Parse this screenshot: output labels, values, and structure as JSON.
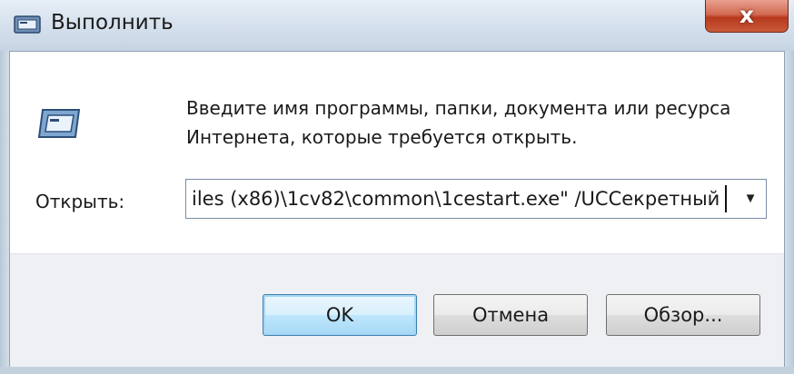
{
  "window": {
    "title": "Выполнить",
    "title_icon": "run-dialog-icon",
    "close_glyph": "x"
  },
  "dialog": {
    "program_icon": "run-program-icon",
    "prompt_line1": "Введите имя программы, папки, документа или ресурса",
    "prompt_line2": "Интернета, которые требуется открыть.",
    "open_label": "Открыть:",
    "open_value": "iles (x86)\\1cv82\\common\\1cestart.exe\" /UCСекретный",
    "dropdown_icon": "chevron-down-icon"
  },
  "buttons": {
    "ok": "OK",
    "cancel": "Отмена",
    "browse": "Обзор..."
  },
  "colors": {
    "default_button_border": "#3c7fb1",
    "close_button": "#c9593a",
    "title_bar": "#d7e2ee"
  }
}
